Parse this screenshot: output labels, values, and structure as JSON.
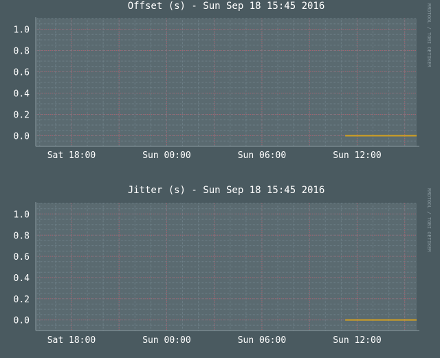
{
  "colors": {
    "background": "#4a5a60",
    "plot_area": "#5a6a70",
    "minor_grid": "#6e8088",
    "major_grid": "#b85868",
    "series": "#d4a020",
    "text": "#ffffff"
  },
  "watermark": "RRDTOOL / TOBI OETIKER",
  "chart_data": [
    {
      "type": "line",
      "title": "Offset (s) - Sun Sep 18 15:45 2016",
      "xlabel": "",
      "ylabel": "",
      "ylim": [
        -0.1,
        1.1
      ],
      "yticks": [
        "1.0",
        "0.8",
        "0.6",
        "0.4",
        "0.2",
        "0.0"
      ],
      "ytick_values": [
        1.0,
        0.8,
        0.6,
        0.4,
        0.2,
        0.0
      ],
      "x_range": [
        "2016-09-17T15:45",
        "2016-09-18T15:45"
      ],
      "xticks": [
        {
          "label": "Sat 18:00",
          "t": "2016-09-17T18:00"
        },
        {
          "label": "Sun 00:00",
          "t": "2016-09-18T00:00"
        },
        {
          "label": "Sun 06:00",
          "t": "2016-09-18T06:00"
        },
        {
          "label": "Sun 12:00",
          "t": "2016-09-18T12:00"
        }
      ],
      "grid": true,
      "series": [
        {
          "x": [
            "2016-09-18T11:15",
            "2016-09-18T15:45"
          ],
          "values": [
            0.0,
            0.0
          ]
        }
      ]
    },
    {
      "type": "line",
      "title": "Jitter (s) - Sun Sep 18 15:45 2016",
      "xlabel": "",
      "ylabel": "",
      "ylim": [
        -0.1,
        1.1
      ],
      "yticks": [
        "1.0",
        "0.8",
        "0.6",
        "0.4",
        "0.2",
        "0.0"
      ],
      "ytick_values": [
        1.0,
        0.8,
        0.6,
        0.4,
        0.2,
        0.0
      ],
      "x_range": [
        "2016-09-17T15:45",
        "2016-09-18T15:45"
      ],
      "xticks": [
        {
          "label": "Sat 18:00",
          "t": "2016-09-17T18:00"
        },
        {
          "label": "Sun 00:00",
          "t": "2016-09-18T00:00"
        },
        {
          "label": "Sun 06:00",
          "t": "2016-09-18T06:00"
        },
        {
          "label": "Sun 12:00",
          "t": "2016-09-18T12:00"
        }
      ],
      "grid": true,
      "series": [
        {
          "x": [
            "2016-09-18T11:15",
            "2016-09-18T15:45"
          ],
          "values": [
            0.0,
            0.0
          ]
        }
      ]
    }
  ]
}
